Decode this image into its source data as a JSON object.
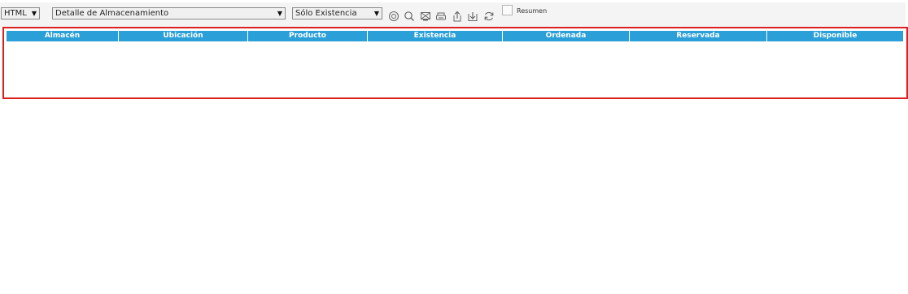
{
  "toolbar": {
    "format_select": {
      "value": "HTML"
    },
    "report_select": {
      "value": "Detalle de Almacenamiento"
    },
    "filter_select": {
      "value": "Sólo Existencia"
    },
    "summary_checkbox": {
      "label": "Resumen",
      "checked": false
    },
    "icons": [
      "settings-icon",
      "search-icon",
      "print-preview-icon",
      "print-icon",
      "export-icon",
      "import-icon",
      "refresh-icon"
    ]
  },
  "grid": {
    "columns": [
      "Almacén",
      "Ubicación",
      "Producto",
      "Existencia",
      "Ordenada",
      "Reservada",
      "Disponible"
    ],
    "rows": []
  },
  "colors": {
    "header_bg": "#2a9fd8",
    "frame_border": "#dd1f1f"
  }
}
